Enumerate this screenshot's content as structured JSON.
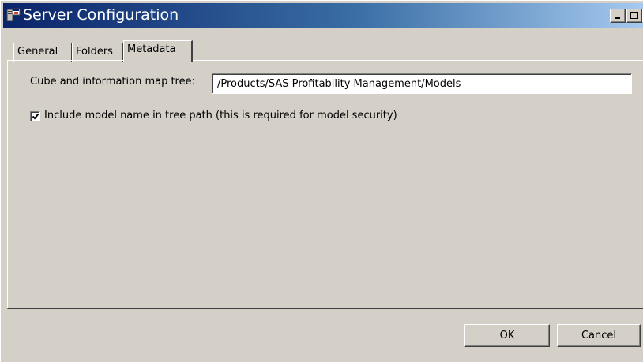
{
  "window": {
    "title": "Server Configuration",
    "icon": "server-config-icon",
    "controls": [
      "minimize-icon",
      "maximize-icon",
      "close-icon"
    ]
  },
  "tabs": [
    {
      "label": "General",
      "active": false
    },
    {
      "label": "Folders",
      "active": false
    },
    {
      "label": "Metadata",
      "active": true
    }
  ],
  "metadata": {
    "path_label": "Cube and information map tree:",
    "path_value": "/Products/SAS Profitability Management/Models",
    "include_model_label": "Include model name in tree path (this is required for model security)",
    "include_model_checked": true
  },
  "buttons": {
    "ok": "OK",
    "cancel": "Cancel"
  },
  "colors": {
    "title_gradient_start": "#0a246a",
    "title_gradient_end": "#a6caf0",
    "face": "#d4d0c8"
  }
}
